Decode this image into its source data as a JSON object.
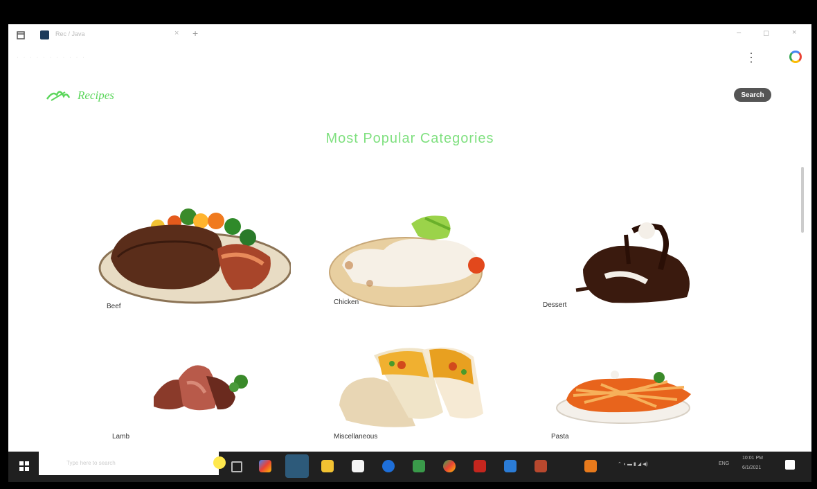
{
  "browser": {
    "tab_title": "Rec / Java",
    "tab_close": "×",
    "new_tab": "+",
    "address": "· · · · · · · · · · ·",
    "menu": "⋮",
    "controls": {
      "minimize": "–",
      "maximize": "◻",
      "close": "×"
    }
  },
  "site": {
    "logo_text": "Recipes",
    "search_label": "Search",
    "heading": "Most Popular Categories"
  },
  "categories": [
    {
      "label": "Beef"
    },
    {
      "label": "Chicken"
    },
    {
      "label": "Dessert"
    },
    {
      "label": "Lamb"
    },
    {
      "label": "Miscellaneous"
    },
    {
      "label": "Pasta"
    }
  ],
  "taskbar": {
    "search_placeholder": "Type here to search",
    "clock_time": "10:01 PM",
    "clock_date": "6/1/2021",
    "language": "ENG"
  },
  "colors": {
    "heading": "#7fe07f",
    "logo": "#5bd65b",
    "search_button": "#555555",
    "taskbar": "#202020"
  }
}
